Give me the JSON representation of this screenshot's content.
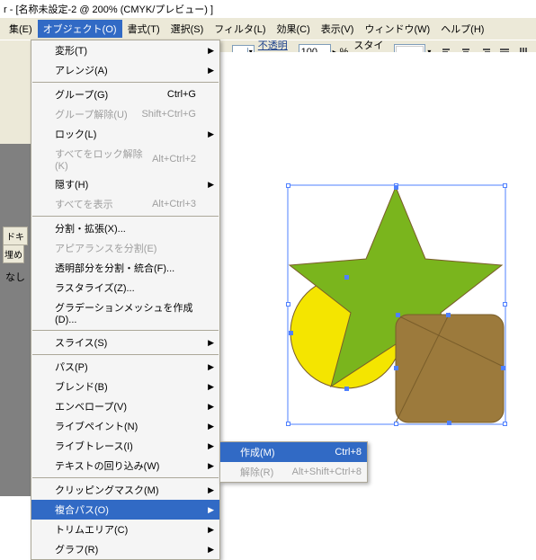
{
  "title": "r - [名称未設定-2 @ 200% (CMYK/プレビュー) ]",
  "menubar": {
    "items": [
      "集(E)",
      "オブジェクト(O)",
      "書式(T)",
      "選択(S)",
      "フィルタ(L)",
      "効果(C)",
      "表示(V)",
      "ウィンドウ(W)",
      "ヘルプ(H)"
    ]
  },
  "toolbar": {
    "opacity_label": "不透明度:",
    "opacity_value": "100",
    "percent": "%",
    "style_label": "スタイル:"
  },
  "left": {
    "nosel": "なし",
    "tab1": "ドキ",
    "tab2": "埋め"
  },
  "dropdown": {
    "items": [
      {
        "label": "変形(T)",
        "sub": true
      },
      {
        "label": "アレンジ(A)",
        "sub": true
      },
      {
        "sep": true
      },
      {
        "label": "グループ(G)",
        "shortcut": "Ctrl+G"
      },
      {
        "label": "グループ解除(U)",
        "shortcut": "Shift+Ctrl+G",
        "disabled": true
      },
      {
        "label": "ロック(L)",
        "sub": true
      },
      {
        "label": "すべてをロック解除(K)",
        "shortcut": "Alt+Ctrl+2",
        "disabled": true
      },
      {
        "label": "隠す(H)",
        "sub": true
      },
      {
        "label": "すべてを表示",
        "shortcut": "Alt+Ctrl+3",
        "disabled": true
      },
      {
        "sep": true
      },
      {
        "label": "分割・拡張(X)..."
      },
      {
        "label": "アピアランスを分割(E)",
        "disabled": true
      },
      {
        "label": "透明部分を分割・統合(F)..."
      },
      {
        "label": "ラスタライズ(Z)..."
      },
      {
        "label": "グラデーションメッシュを作成(D)..."
      },
      {
        "sep": true
      },
      {
        "label": "スライス(S)",
        "sub": true
      },
      {
        "sep": true
      },
      {
        "label": "パス(P)",
        "sub": true
      },
      {
        "label": "ブレンド(B)",
        "sub": true
      },
      {
        "label": "エンベロープ(V)",
        "sub": true
      },
      {
        "label": "ライブペイント(N)",
        "sub": true
      },
      {
        "label": "ライブトレース(I)",
        "sub": true
      },
      {
        "label": "テキストの回り込み(W)",
        "sub": true
      },
      {
        "sep": true
      },
      {
        "label": "クリッピングマスク(M)",
        "sub": true
      },
      {
        "label": "複合パス(O)",
        "sub": true,
        "highlight": true
      },
      {
        "label": "トリムエリア(C)",
        "sub": true
      },
      {
        "label": "グラフ(R)",
        "sub": true
      }
    ]
  },
  "submenu": {
    "items": [
      {
        "label": "作成(M)",
        "shortcut": "Ctrl+8",
        "highlight": true
      },
      {
        "label": "解除(R)",
        "shortcut": "Alt+Shift+Ctrl+8",
        "disabled": true
      }
    ]
  }
}
